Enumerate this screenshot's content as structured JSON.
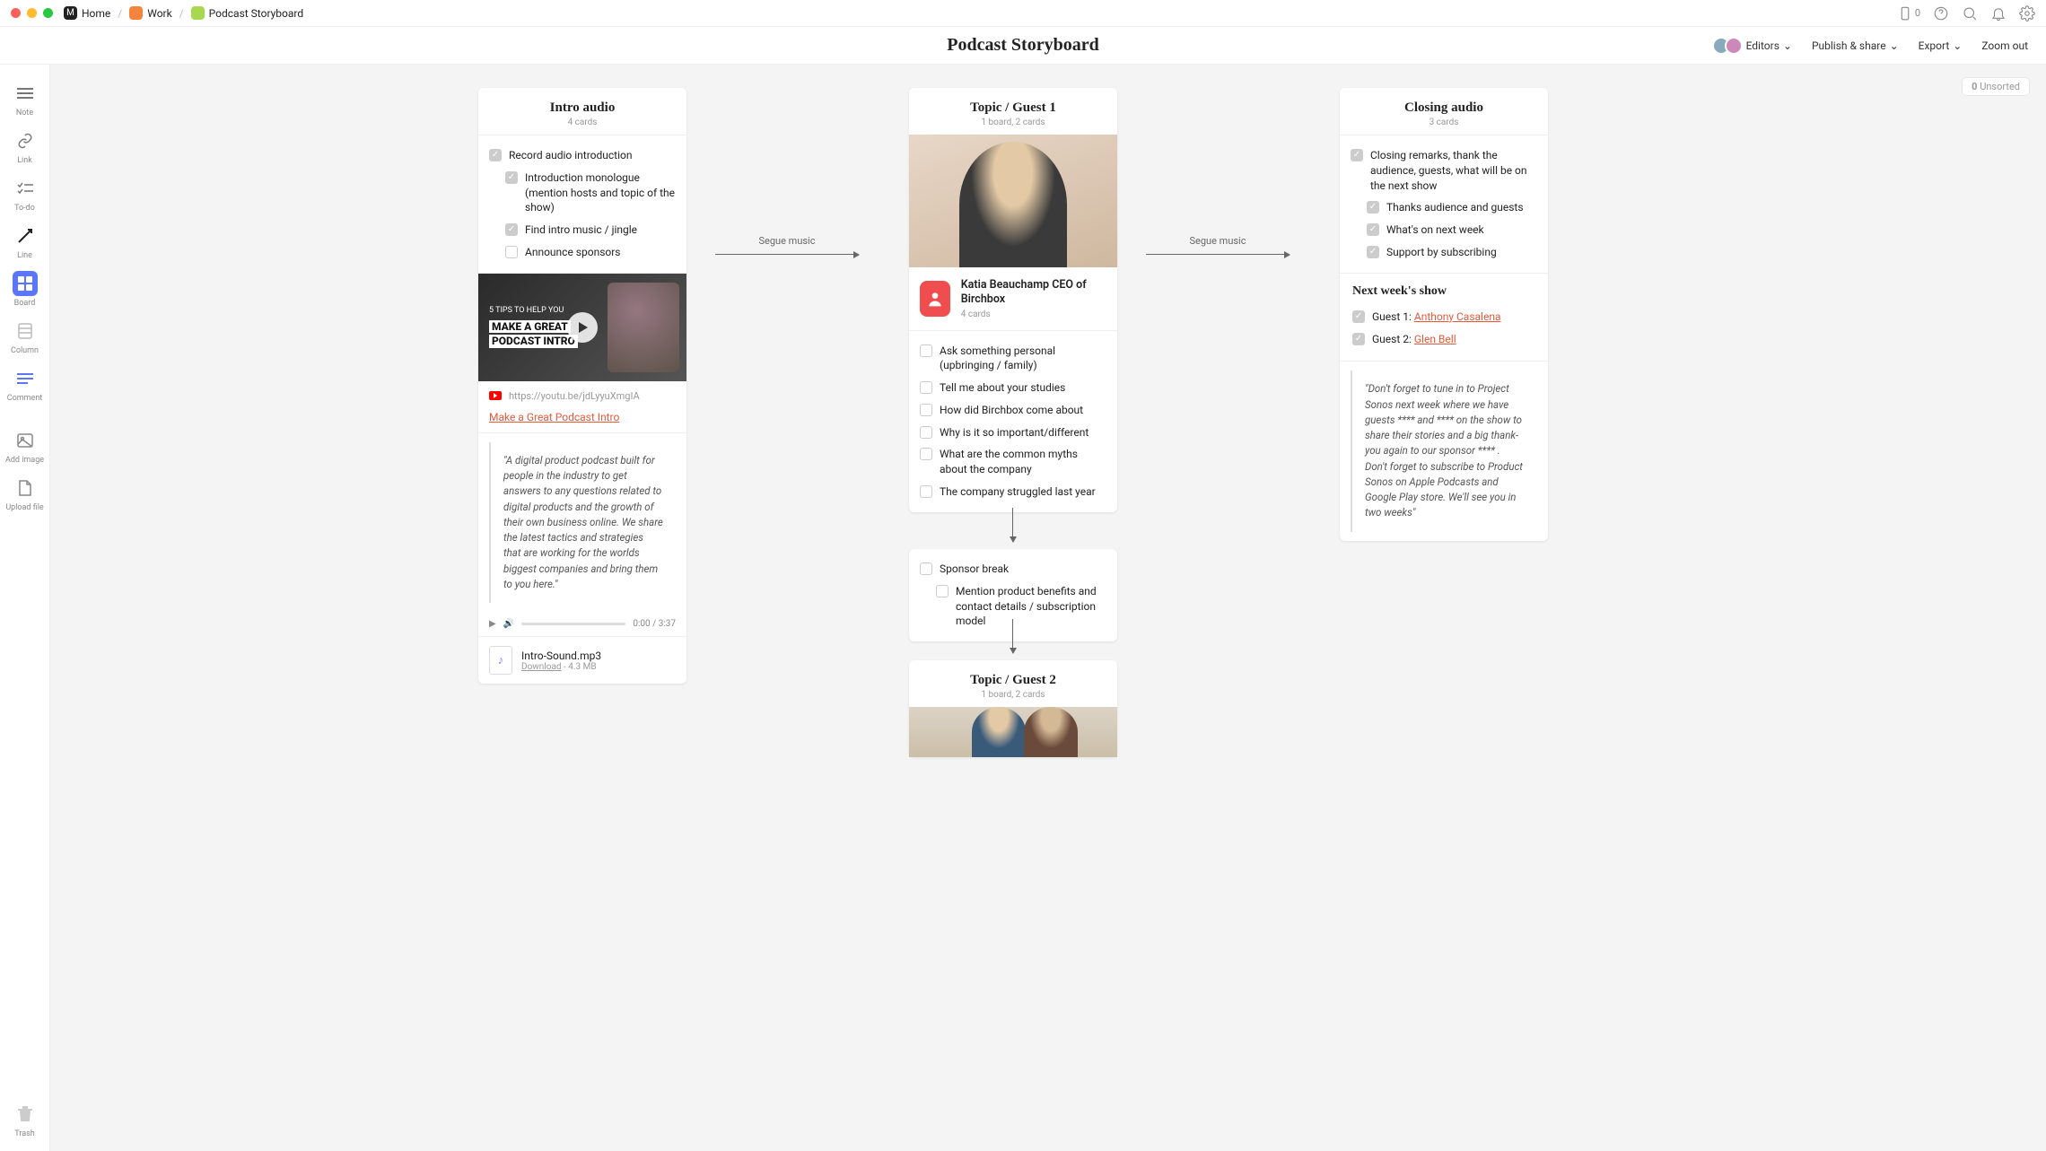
{
  "breadcrumb": {
    "home": "Home",
    "work": "Work",
    "current": "Podcast Storyboard"
  },
  "device_count": "0",
  "title": "Podcast Storyboard",
  "header": {
    "editors": "Editors",
    "publish": "Publish & share",
    "export": "Export",
    "zoom": "Zoom out"
  },
  "unsorted": {
    "count": "0",
    "label": "Unsorted"
  },
  "rail": {
    "note": "Note",
    "link": "Link",
    "todo": "To-do",
    "line": "Line",
    "board": "Board",
    "column": "Column",
    "comment": "Comment",
    "addimage": "Add image",
    "upload": "Upload file",
    "trash": "Trash"
  },
  "connectors": {
    "left": "Segue music",
    "right": "Segue music"
  },
  "col1": {
    "title": "Intro audio",
    "sub": "4 cards",
    "tasks": {
      "t1": "Record audio introduction",
      "t1a": "Introduction monologue (mention hosts and topic of the show)",
      "t1b": "Find intro music / jingle",
      "t1c": "Announce sponsors"
    },
    "video_overline": "5 TIPS TO HELP YOU",
    "video_line1": "MAKE A GREAT",
    "video_line2": "PODCAST INTRO",
    "yt_url": "https://youtu.be/jdLyyuXmgIA",
    "yt_title": "Make a Great Podcast Intro",
    "quote": "\"A digital product podcast built for people in the industry to get answers to any questions related to digital products and the growth of their own business online. We share the latest tactics and strategies that are working for the worlds biggest companies and bring them to you here.\"",
    "audio_time": "0:00 / 3:37",
    "file_name": "Intro-Sound.mp3",
    "file_download": "Download",
    "file_size": "- 4.3 MB"
  },
  "col2": {
    "title": "Topic / Guest 1",
    "sub": "1 board, 2 cards",
    "guest_name": "Katia Beauchamp CEO of Birchbox",
    "guest_sub": "4 cards",
    "q1": "Ask something personal (upbringing / family)",
    "q2": "Tell me about your studies",
    "q3": "How did Birchbox come about",
    "q4": "Why is it so important/different",
    "q5": "What are the common myths about the company",
    "q6": "The company struggled last year"
  },
  "sponsor": {
    "s1": "Sponsor break",
    "s1a": "Mention product benefits and contact details / subscription model"
  },
  "col2b": {
    "title": "Topic / Guest 2",
    "sub": "1 board, 2 cards"
  },
  "col3": {
    "title": "Closing audio",
    "sub": "3 cards",
    "t1": "Closing remarks, thank the audience, guests, what will be on the next show",
    "t1a": "Thanks audience and guests",
    "t1b": "What's on next week",
    "t1c": "Support by subscribing",
    "next_title": "Next week's show",
    "g1_label": "Guest 1: ",
    "g1_name": "Anthony Casalena",
    "g2_label": "Guest 2: ",
    "g2_name": "Glen Bell",
    "quote": "\"Don't forget to tune in to Project Sonos next week where we have guests **** and **** on the show to share their stories and a big thank-you again to our sponsor **** . Don't forget to subscribe to Product Sonos on Apple Podcasts and Google Play store. We'll see you in two weeks\""
  }
}
